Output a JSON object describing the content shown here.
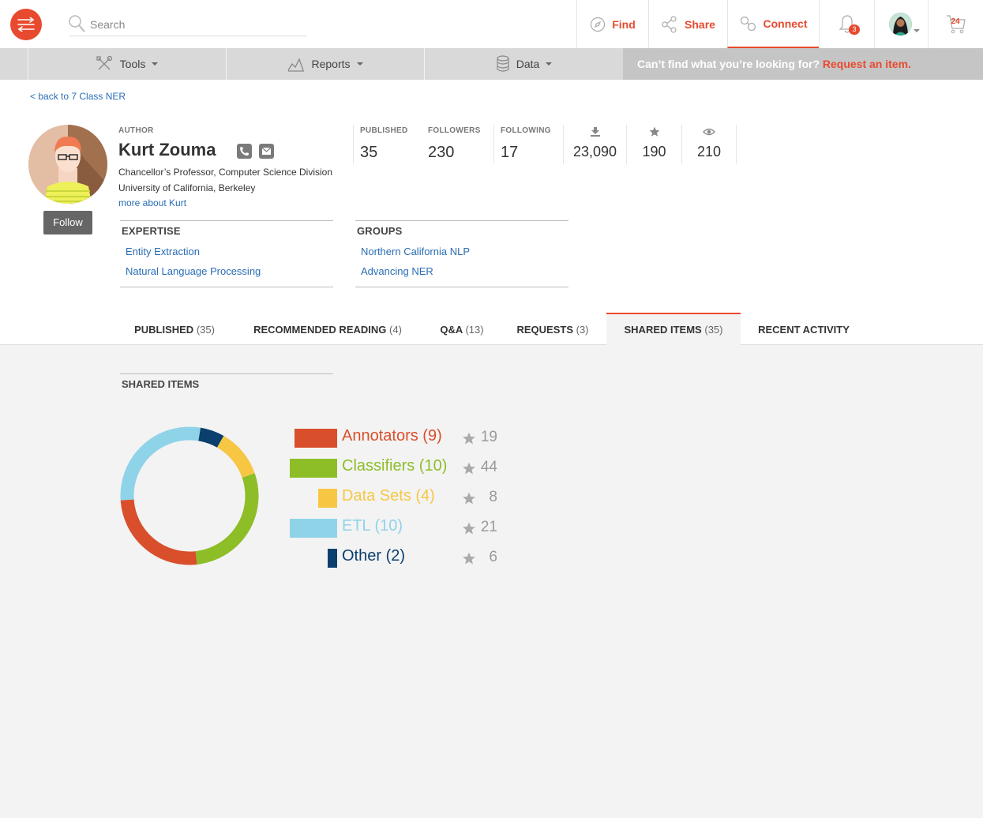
{
  "search": {
    "placeholder": "Search"
  },
  "nav": {
    "find": "Find",
    "share": "Share",
    "connect": "Connect",
    "notifications_count": "3",
    "cart_count": "24"
  },
  "subnav": {
    "tools": "Tools",
    "reports": "Reports",
    "data": "Data",
    "request_prompt": "Can’t find what you’re looking for?",
    "request_link": "Request an item."
  },
  "profile": {
    "back_link": "< back to 7 Class NER",
    "author_label": "AUTHOR",
    "name": "Kurt Zouma",
    "title": "Chancellor’s Professor, Computer Science Division",
    "organization": "University of California, Berkeley",
    "more_link": "more about Kurt",
    "follow_label": "Follow",
    "stats": {
      "published_label": "PUBLISHED",
      "published": "35",
      "followers_label": "FOLLOWERS",
      "followers": "230",
      "following_label": "FOLLOWING",
      "following": "17",
      "downloads": "23,090",
      "stars": "190",
      "views": "210"
    },
    "expertise": {
      "title": "EXPERTISE",
      "items": [
        "Entity Extraction",
        "Natural Language Processing"
      ]
    },
    "groups": {
      "title": "GROUPS",
      "items": [
        "Northern California NLP",
        "Advancing NER"
      ]
    }
  },
  "tabs": [
    {
      "label": "PUBLISHED",
      "count": "(35)"
    },
    {
      "label": "RECOMMENDED READING",
      "count": "(4)"
    },
    {
      "label": "Q&A",
      "count": "(13)"
    },
    {
      "label": "REQUESTS",
      "count": "(3)"
    },
    {
      "label": "SHARED ITEMS",
      "count": "(35)"
    },
    {
      "label": "RECENT ACTIVITY",
      "count": ""
    }
  ],
  "shared_items": {
    "title": "SHARED ITEMS",
    "categories": [
      {
        "label": "Annotators (9)",
        "count": 9,
        "stars": "19",
        "color": "#d94f2b"
      },
      {
        "label": "Classifiers (10)",
        "count": 10,
        "stars": "44",
        "color": "#8dbe28"
      },
      {
        "label": "Data Sets (4)",
        "count": 4,
        "stars": "8",
        "color": "#f7c744"
      },
      {
        "label": "ETL (10)",
        "count": 10,
        "stars": "21",
        "color": "#8fd3e8"
      },
      {
        "label": "Other (2)",
        "count": 2,
        "stars": "6",
        "color": "#0b3f6e"
      }
    ]
  }
}
